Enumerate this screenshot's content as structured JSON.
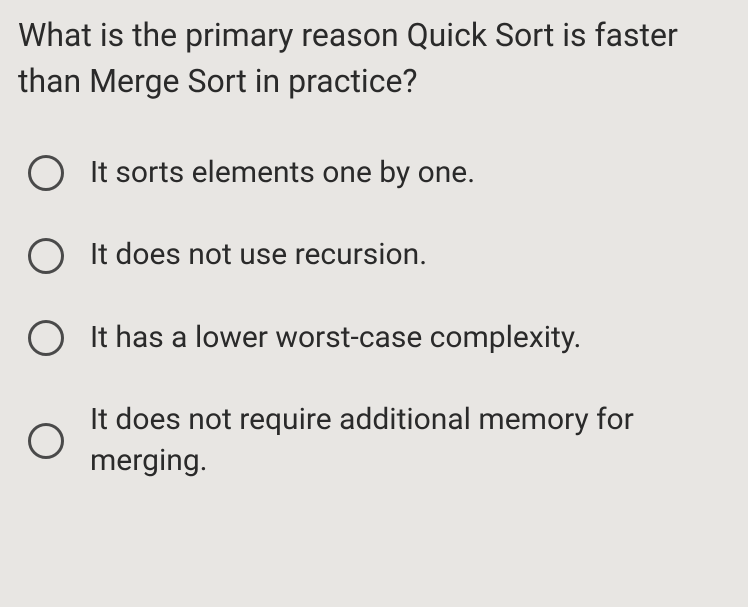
{
  "question": {
    "text": "What is the primary reason Quick Sort is faster than Merge Sort in practice?"
  },
  "options": [
    {
      "label": "It sorts elements one by one."
    },
    {
      "label": "It does not use recursion."
    },
    {
      "label": "It has a lower worst-case complexity."
    },
    {
      "label": "It does not require additional memory for merging."
    }
  ]
}
